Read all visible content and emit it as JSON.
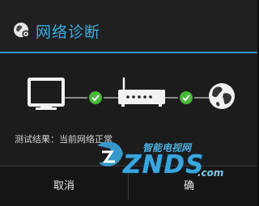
{
  "dialog": {
    "title": "网络诊断",
    "title_icon": "globe-gear-icon",
    "accent_color": "#37aee4"
  },
  "diagram": {
    "nodes": [
      {
        "name": "tv-icon"
      },
      {
        "name": "router-icon"
      },
      {
        "name": "globe-icon"
      }
    ],
    "links": [
      {
        "status": "ok",
        "icon": "check-icon",
        "color": "#48b83a"
      },
      {
        "status": "ok",
        "icon": "check-icon",
        "color": "#48b83a"
      }
    ]
  },
  "result": {
    "text": "测试结果：当前网络正常"
  },
  "buttons": {
    "cancel": "取消",
    "confirm": "确"
  },
  "watermark": {
    "cn_text": "智能电视网",
    "brand": "ZNDS",
    "domain": ".com",
    "color": "#3aa6de"
  }
}
